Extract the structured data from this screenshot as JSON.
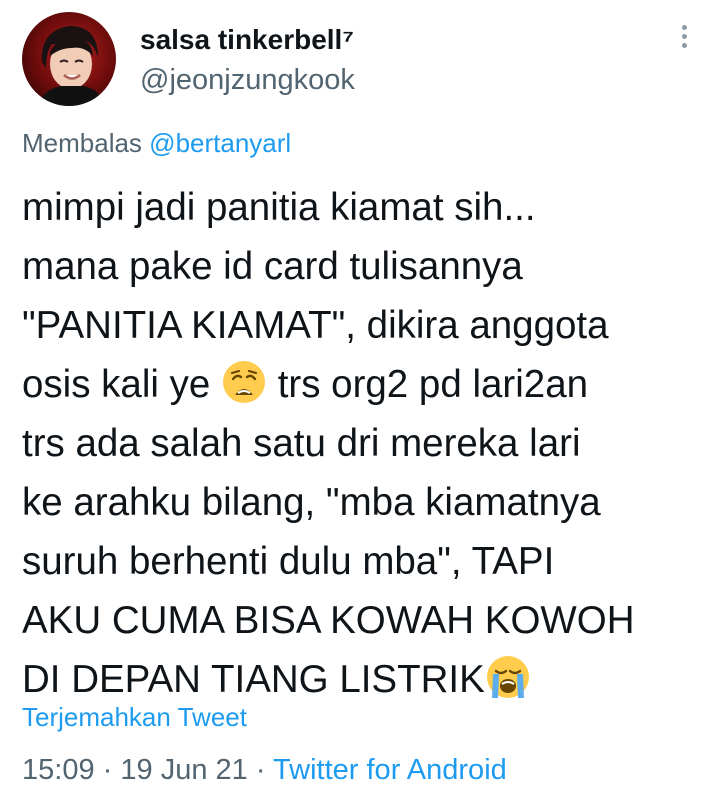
{
  "author": {
    "display_name": "salsa tinkerbell⁷",
    "handle": "@jeonjzungkook"
  },
  "reply": {
    "prefix": "Membalas",
    "handle": "@bertanyarl"
  },
  "tweet": {
    "lines": [
      "mimpi jadi panitia kiamat sih...",
      "mana pake id card tulisannya",
      "\"PANITIA KIAMAT\", dikira anggota",
      "osis kali ye",
      "trs org2 pd lari2an",
      "trs ada salah satu dri mereka lari",
      "ke arahku bilang, \"mba kiamatnya",
      "suruh berhenti dulu mba\", TAPI",
      "AKU CUMA BISA KOWAH KOWOH",
      "DI DEPAN TIANG LISTRIK"
    ],
    "emojis": [
      "weary-face-emoji",
      "loudly-crying-face-emoji"
    ]
  },
  "translate_label": "Terjemahkan Tweet",
  "meta": {
    "time": "15:09",
    "separator": "·",
    "date": "19 Jun 21",
    "source": "Twitter for Android"
  },
  "colors": {
    "accent": "#1d9bf0",
    "secondary_text": "#536471",
    "primary_text": "#0f1419"
  },
  "icons": [
    "more-options-icon"
  ]
}
